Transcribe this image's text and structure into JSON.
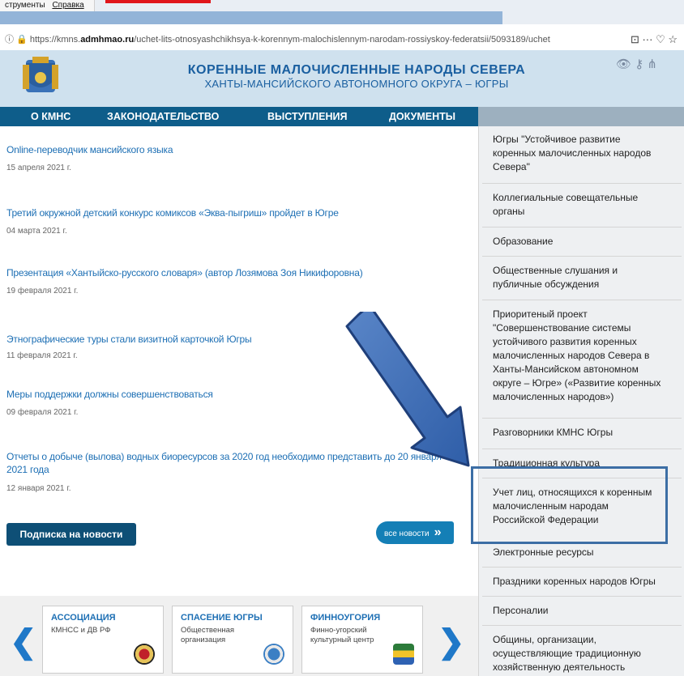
{
  "browser": {
    "menu": [
      "струменты",
      "Справка"
    ],
    "url_prefix": "https://kmns.",
    "url_domain": "admhmao.ru",
    "url_rest": "/uchet-lits-otnosyashchikhsya-k-korennym-malochislennym-narodam-rossiyskoy-federatsii/5093189/uchet",
    "toolbar_icons": "⊡  ···  ♡  ☆"
  },
  "header": {
    "title_line1": "КОРЕННЫЕ МАЛОЧИСЛЕННЫЕ НАРОДЫ СЕВЕРА",
    "title_line2": "ХАНТЫ-МАНСИЙСКОГО АВТОНОМНОГО ОКРУГА – ЮГРЫ"
  },
  "nav": [
    "О КМНС",
    "ЗАКОНОДАТЕЛЬСТВО",
    "ВЫСТУПЛЕНИЯ",
    "ДОКУМЕНТЫ"
  ],
  "news": [
    {
      "title": "Online-переводчик мансийского языка",
      "date": "15 апреля 2021 г."
    },
    {
      "title": "Третий окружной детский конкурс комиксов «Эква-пыгриш» пройдет в Югре",
      "date": "04 марта 2021 г."
    },
    {
      "title": "Презентация «Хантыйско-русского словаря» (автор Лозямова Зоя Никифоровна)",
      "date": "19 февраля 2021 г."
    },
    {
      "title": "Этнографические туры стали визитной карточкой Югры",
      "date": "11 февраля 2021 г."
    },
    {
      "title": "Меры поддержки должны совершенствоваться",
      "date": "09 февраля 2021 г."
    },
    {
      "title": "Отчеты о добыче (вылова) водных биоресурсов за 2020 год необходимо представить до 20 января 2021 года",
      "date": "12 января 2021 г."
    }
  ],
  "buttons": {
    "subscribe": "Подписка на новости",
    "all_news": "все новости",
    "all_news_chevron": "»"
  },
  "partners": [
    {
      "title": "АССОЦИАЦИЯ",
      "subtitle": "КМНСС и ДВ РФ"
    },
    {
      "title": "СПАСЕНИЕ ЮГРЫ",
      "subtitle": "Общественная организация"
    },
    {
      "title": "ФИННОУГОРИЯ",
      "subtitle": "Финно-угорский культурный центр"
    }
  ],
  "sidebar": [
    "Югры \"Устойчивое развитие коренных малочисленных народов Севера\"",
    "Коллегиальные совещательные органы",
    "Образование",
    "Общественные слушания и публичные обсуждения",
    "Приоритеный проект \"Совершенствование системы устойчивого развития коренных малочисленных народов Севера в Ханты-Мансийском автономном округе – Югре» («Развитие коренных малочисленных народов»)",
    "Разговорники КМНС Югры",
    "Традиционная культура",
    "Учет лиц, относящихся к коренным малочисленным народам Российской Федерации",
    "Электронные ресурсы",
    "Праздники коренных народов Югры",
    "Персоналии",
    "Общины, организации, осуществляющие традиционную хозяйственную деятельность"
  ],
  "colors": {
    "nav": "#0e5d8a",
    "link": "#1d6fb4",
    "highlight": "#3c6ea5",
    "arrow": "#3f6db5"
  }
}
